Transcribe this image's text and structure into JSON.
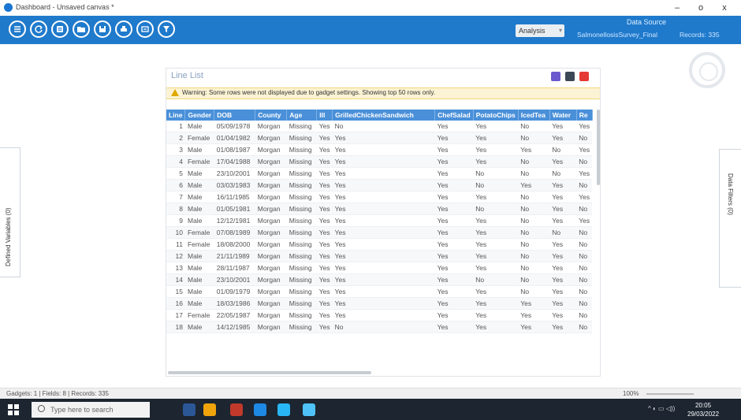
{
  "window": {
    "title": "Dashboard - Unsaved canvas *",
    "minimize": "–",
    "maximize": "o",
    "close": "x"
  },
  "toolbar": {
    "icons": [
      "menu-icon",
      "refresh-icon",
      "list-icon",
      "folder-icon",
      "save-icon",
      "print-icon",
      "chart-icon",
      "filter-icon"
    ],
    "analysis_label": "Analysis",
    "data_source_label": "Data Source",
    "data_source_name": "SalmonellosisSurvey_Final",
    "records": "Records: 335"
  },
  "canvas": {
    "left_tab": "Defined Variables (0)",
    "right_tab": "Data Filters (0)"
  },
  "gadget": {
    "title": "Line List",
    "warning": "Warning: Some rows were not displayed due to gadget settings. Showing top 50 rows only.",
    "columns": [
      "Line",
      "Gender",
      "DOB",
      "County",
      "Age",
      "Ill",
      "GrilledChickenSandwich",
      "ChefSalad",
      "PotatoChips",
      "IcedTea",
      "Water",
      "Re"
    ],
    "rows": [
      [
        "1",
        "Male",
        "05/09/1978",
        "Morgan",
        "Missing",
        "Yes",
        "No",
        "Yes",
        "Yes",
        "No",
        "Yes",
        "Yes"
      ],
      [
        "2",
        "Female",
        "01/04/1982",
        "Morgan",
        "Missing",
        "Yes",
        "Yes",
        "Yes",
        "Yes",
        "No",
        "Yes",
        "No"
      ],
      [
        "3",
        "Male",
        "01/08/1987",
        "Morgan",
        "Missing",
        "Yes",
        "Yes",
        "Yes",
        "Yes",
        "Yes",
        "No",
        "Yes"
      ],
      [
        "4",
        "Female",
        "17/04/1988",
        "Morgan",
        "Missing",
        "Yes",
        "Yes",
        "Yes",
        "Yes",
        "No",
        "Yes",
        "No"
      ],
      [
        "5",
        "Male",
        "23/10/2001",
        "Morgan",
        "Missing",
        "Yes",
        "Yes",
        "Yes",
        "No",
        "No",
        "No",
        "Yes"
      ],
      [
        "6",
        "Male",
        "03/03/1983",
        "Morgan",
        "Missing",
        "Yes",
        "Yes",
        "Yes",
        "No",
        "Yes",
        "Yes",
        "No"
      ],
      [
        "7",
        "Male",
        "16/11/1985",
        "Morgan",
        "Missing",
        "Yes",
        "Yes",
        "Yes",
        "Yes",
        "No",
        "Yes",
        "Yes"
      ],
      [
        "8",
        "Male",
        "01/05/1981",
        "Morgan",
        "Missing",
        "Yes",
        "Yes",
        "Yes",
        "No",
        "No",
        "Yes",
        "No"
      ],
      [
        "9",
        "Male",
        "12/12/1981",
        "Morgan",
        "Missing",
        "Yes",
        "Yes",
        "Yes",
        "Yes",
        "No",
        "Yes",
        "Yes"
      ],
      [
        "10",
        "Female",
        "07/08/1989",
        "Morgan",
        "Missing",
        "Yes",
        "Yes",
        "Yes",
        "Yes",
        "No",
        "No",
        "No"
      ],
      [
        "11",
        "Female",
        "18/08/2000",
        "Morgan",
        "Missing",
        "Yes",
        "Yes",
        "Yes",
        "Yes",
        "No",
        "Yes",
        "No"
      ],
      [
        "12",
        "Male",
        "21/11/1989",
        "Morgan",
        "Missing",
        "Yes",
        "Yes",
        "Yes",
        "Yes",
        "No",
        "Yes",
        "No"
      ],
      [
        "13",
        "Male",
        "28/11/1987",
        "Morgan",
        "Missing",
        "Yes",
        "Yes",
        "Yes",
        "Yes",
        "No",
        "Yes",
        "No"
      ],
      [
        "14",
        "Male",
        "23/10/2001",
        "Morgan",
        "Missing",
        "Yes",
        "Yes",
        "Yes",
        "No",
        "No",
        "Yes",
        "No"
      ],
      [
        "15",
        "Male",
        "01/09/1979",
        "Morgan",
        "Missing",
        "Yes",
        "Yes",
        "Yes",
        "Yes",
        "No",
        "Yes",
        "No"
      ],
      [
        "16",
        "Male",
        "18/03/1986",
        "Morgan",
        "Missing",
        "Yes",
        "Yes",
        "Yes",
        "Yes",
        "Yes",
        "Yes",
        "No"
      ],
      [
        "17",
        "Female",
        "22/05/1987",
        "Morgan",
        "Missing",
        "Yes",
        "Yes",
        "Yes",
        "Yes",
        "Yes",
        "Yes",
        "No"
      ],
      [
        "18",
        "Male",
        "14/12/1985",
        "Morgan",
        "Missing",
        "Yes",
        "No",
        "Yes",
        "Yes",
        "Yes",
        "Yes",
        "No"
      ]
    ]
  },
  "statusbar": {
    "text": "Gadgets: 1 | Fields: 8 | Records: 335",
    "zoom": "100%"
  },
  "taskbar": {
    "search_placeholder": "Type here to search",
    "time": "20:05",
    "date": "29/03/2022"
  },
  "colors": {
    "ribbon": "#1f7acc",
    "header": "#4a90d9",
    "warning_bg": "#fbf3d4"
  }
}
